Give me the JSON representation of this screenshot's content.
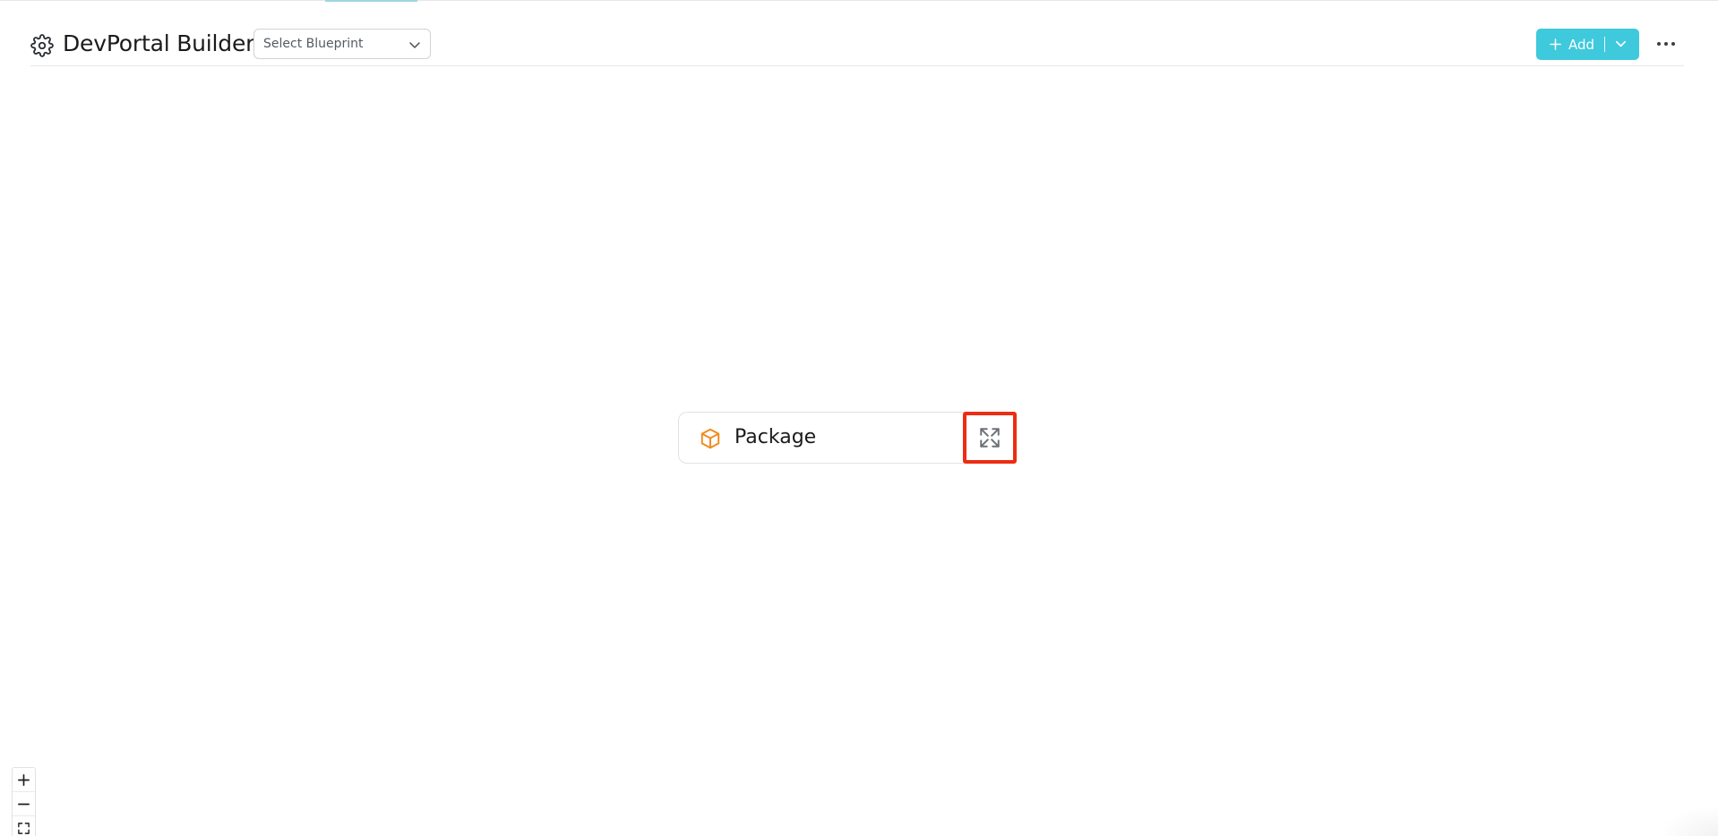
{
  "header": {
    "title": "DevPortal Builder",
    "settings_icon": "gear-icon",
    "blueprint_select": {
      "placeholder": "Select Blueprint",
      "icon": "chevron-down-icon"
    },
    "add_button": {
      "label": "Add",
      "plus_icon": "plus-icon",
      "dropdown_icon": "chevron-down-icon",
      "color": "#3fc9dc"
    },
    "more_icon": "more-horizontal-icon"
  },
  "canvas": {
    "node": {
      "label": "Package",
      "icon": "package-icon",
      "icon_color": "#f08c1d",
      "expand_icon": "expand-icon",
      "highlight_color": "#ec2d13"
    },
    "controls": {
      "zoom_in_icon": "plus-icon",
      "zoom_out_icon": "minus-icon",
      "fit_view_icon": "fit-view-icon"
    }
  }
}
